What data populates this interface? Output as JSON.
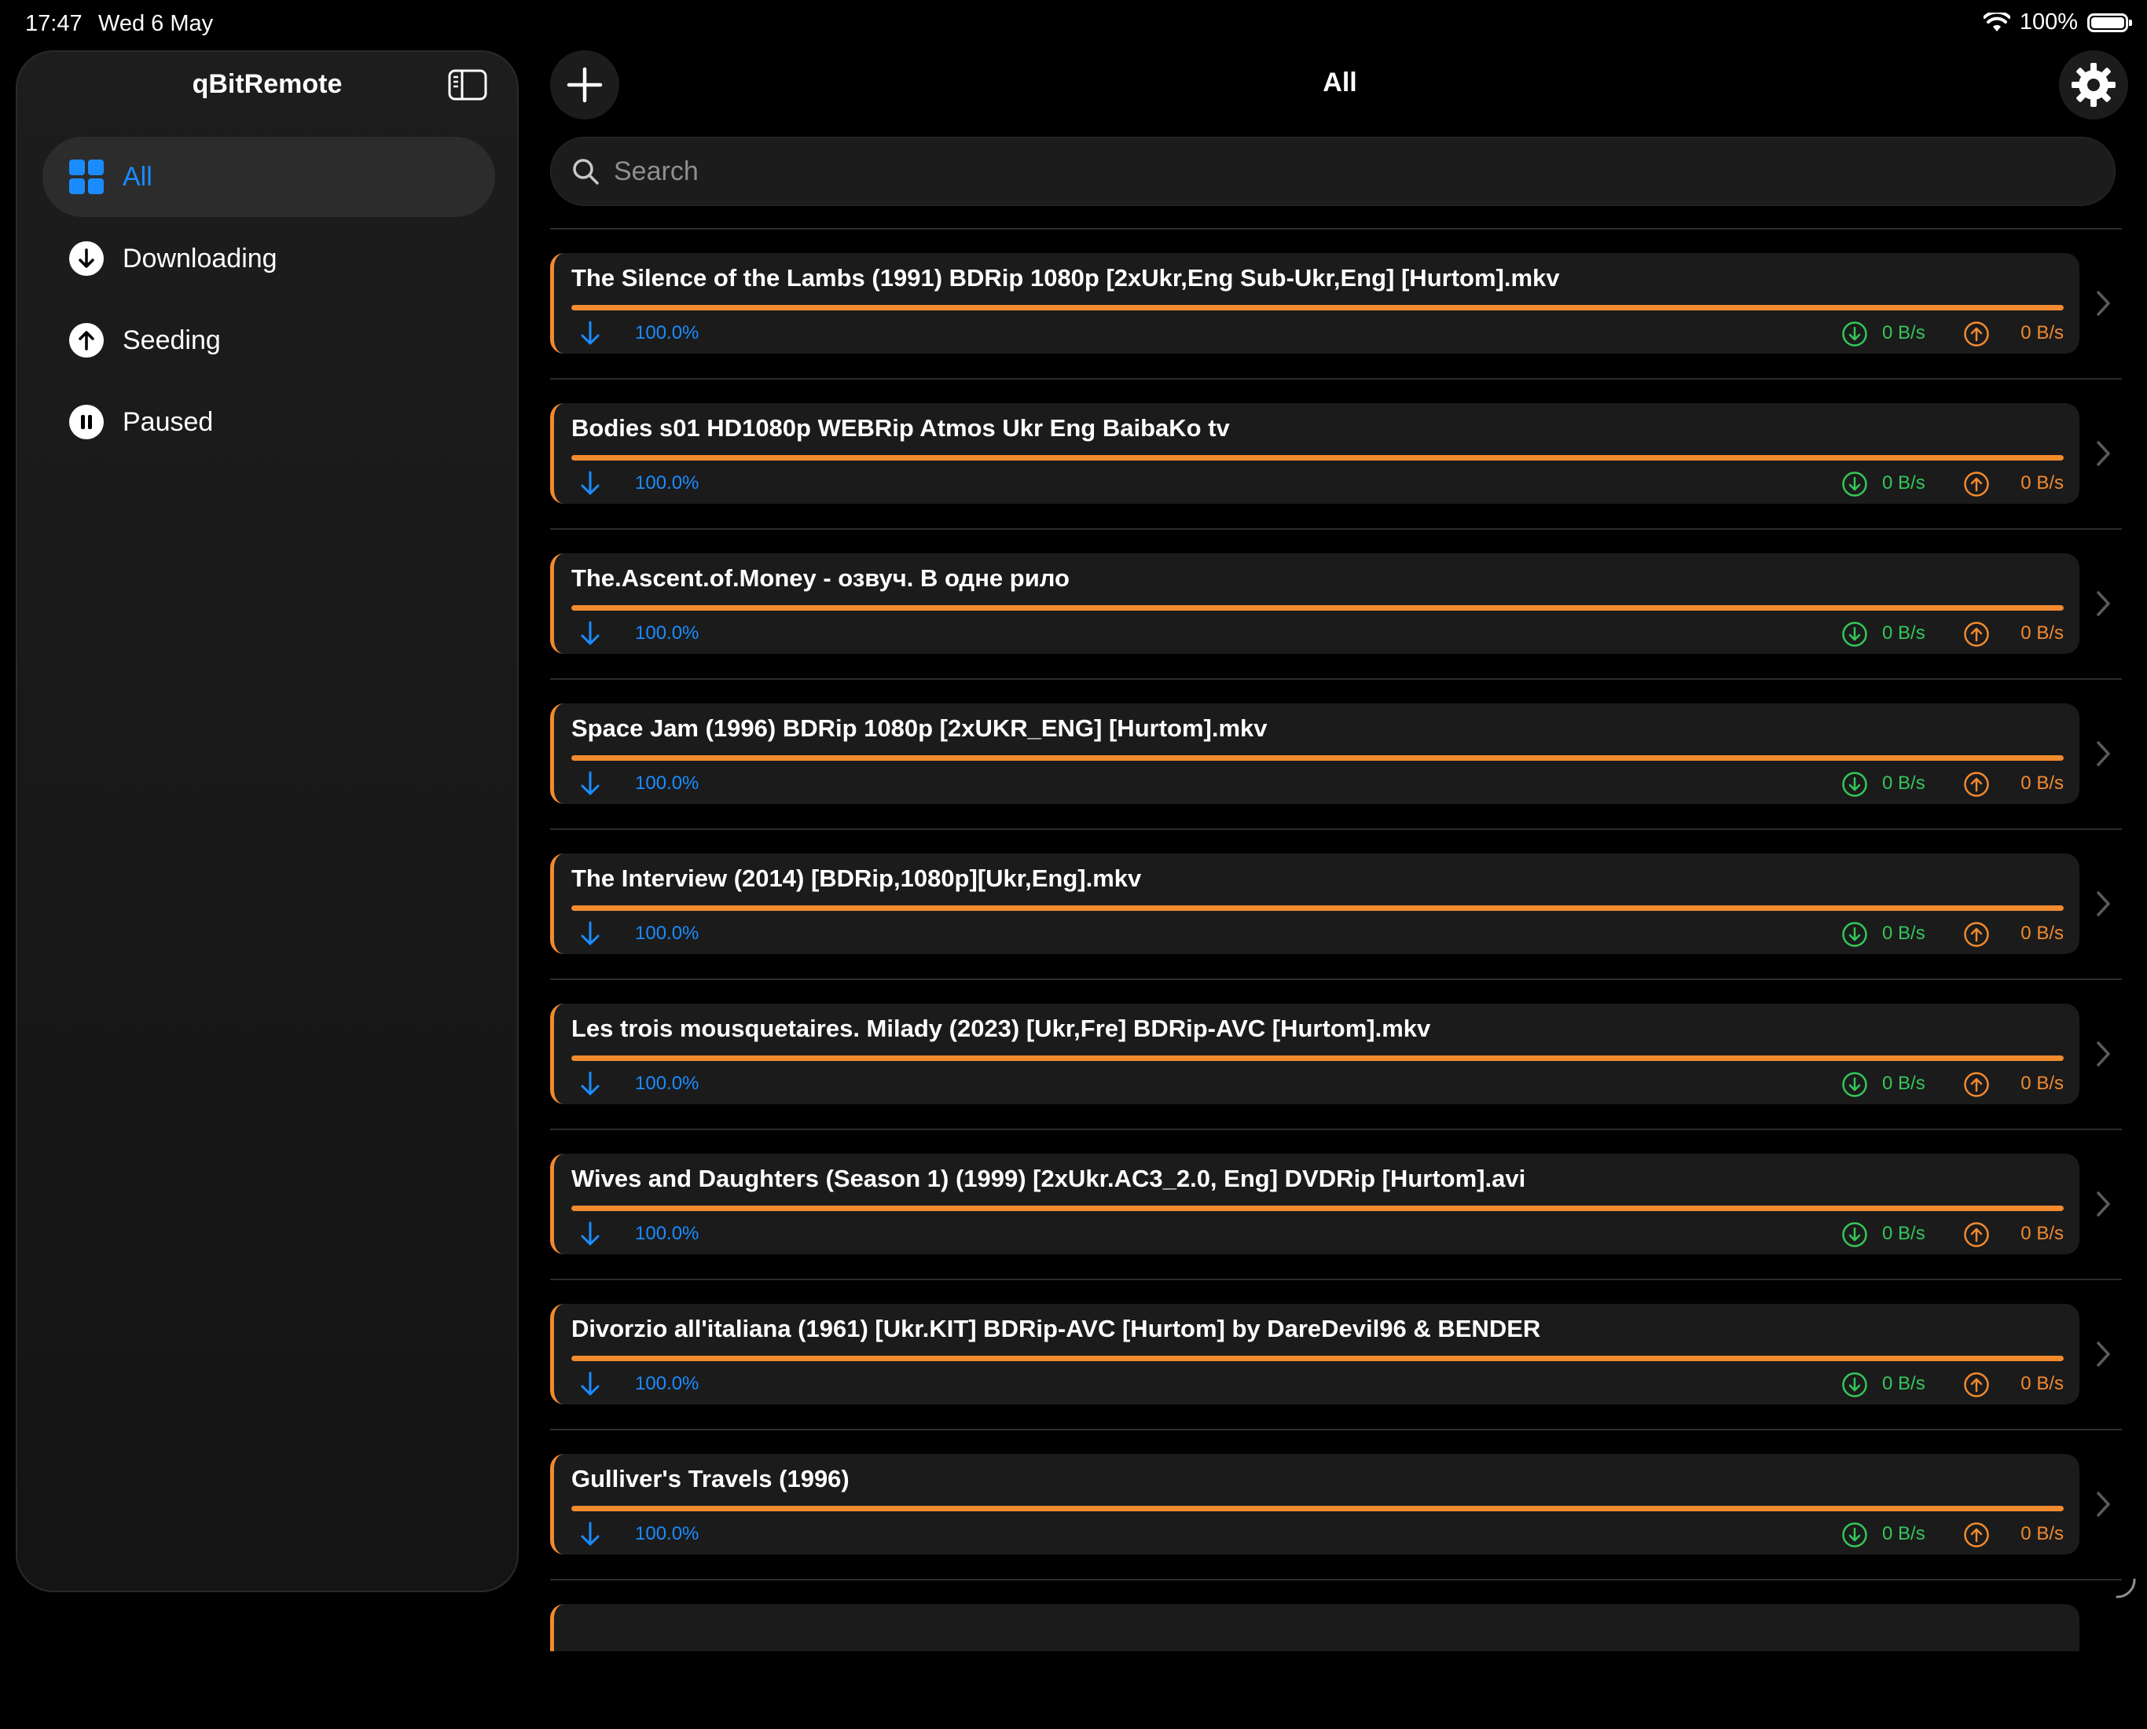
{
  "status_bar": {
    "time": "17:47",
    "date": "Wed 6 May",
    "battery": "100%"
  },
  "sidebar": {
    "title": "qBitRemote",
    "items": [
      {
        "label": "All",
        "icon": "grid-icon",
        "active": true
      },
      {
        "label": "Downloading",
        "icon": "arrow-down-circle-icon",
        "active": false
      },
      {
        "label": "Seeding",
        "icon": "arrow-up-circle-icon",
        "active": false
      },
      {
        "label": "Paused",
        "icon": "pause-circle-icon",
        "active": false
      }
    ]
  },
  "main": {
    "title": "All",
    "search_placeholder": "Search"
  },
  "colors": {
    "accent": "#1a8cff",
    "progress": "#f28a2e",
    "download": "#34c759",
    "upload": "#f28a2e"
  },
  "torrents": [
    {
      "name": "The Silence of the Lambs (1991) BDRip 1080p [2xUkr,Eng Sub-Ukr,Eng] [Hurtom].mkv",
      "progress": "100.0%",
      "progress_fraction": 1.0,
      "dl_speed": "0 B/s",
      "ul_speed": "0 B/s"
    },
    {
      "name": "Bodies s01 HD1080p WEBRip Atmos Ukr Eng BaibaKo tv",
      "progress": "100.0%",
      "progress_fraction": 1.0,
      "dl_speed": "0 B/s",
      "ul_speed": "0 B/s"
    },
    {
      "name": "The.Ascent.of.Money - озвуч. В одне рило",
      "progress": "100.0%",
      "progress_fraction": 1.0,
      "dl_speed": "0 B/s",
      "ul_speed": "0 B/s"
    },
    {
      "name": "Space Jam (1996) BDRip 1080p [2xUKR_ENG] [Hurtom].mkv",
      "progress": "100.0%",
      "progress_fraction": 1.0,
      "dl_speed": "0 B/s",
      "ul_speed": "0 B/s"
    },
    {
      "name": "The Interview (2014) [BDRip,1080p][Ukr,Eng].mkv",
      "progress": "100.0%",
      "progress_fraction": 1.0,
      "dl_speed": "0 B/s",
      "ul_speed": "0 B/s"
    },
    {
      "name": "Les trois mousquetaires. Milady (2023) [Ukr,Fre] BDRip-AVC [Hurtom].mkv",
      "progress": "100.0%",
      "progress_fraction": 1.0,
      "dl_speed": "0 B/s",
      "ul_speed": "0 B/s"
    },
    {
      "name": "Wives and Daughters (Season 1) (1999) [2xUkr.AC3_2.0, Eng] DVDRip [Hurtom].avi",
      "progress": "100.0%",
      "progress_fraction": 1.0,
      "dl_speed": "0 B/s",
      "ul_speed": "0 B/s"
    },
    {
      "name": "Divorzio all'italiana (1961) [Ukr.KIT] BDRip-AVC [Hurtom] by DareDevil96 & BENDER",
      "progress": "100.0%",
      "progress_fraction": 1.0,
      "dl_speed": "0 B/s",
      "ul_speed": "0 B/s"
    },
    {
      "name": "Gulliver's Travels (1996)",
      "progress": "100.0%",
      "progress_fraction": 1.0,
      "dl_speed": "0 B/s",
      "ul_speed": "0 B/s"
    }
  ]
}
